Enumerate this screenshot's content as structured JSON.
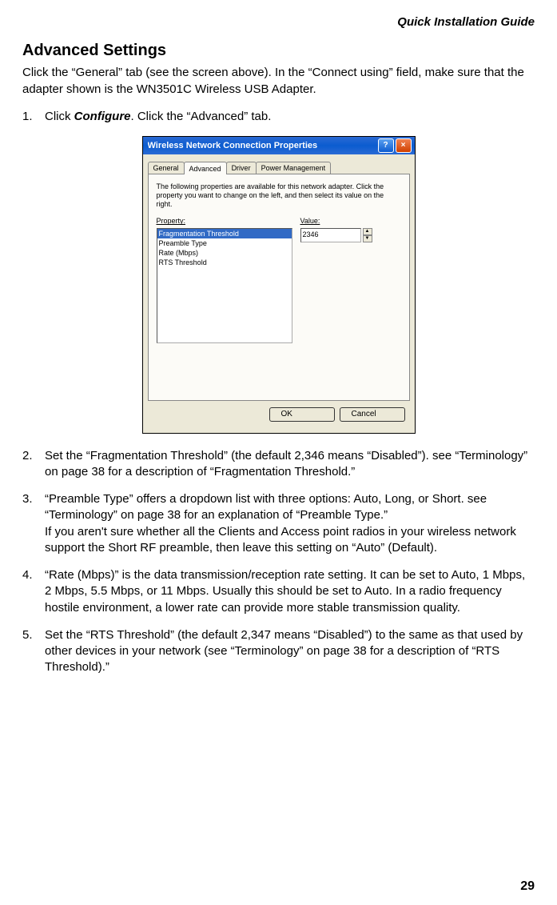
{
  "header": {
    "doc_title": "Quick Installation Guide"
  },
  "section": {
    "heading": "Advanced Settings",
    "intro": "Click the “General” tab (see the screen above). In the “Connect using” field, make sure that the adapter shown is the WN3501C Wireless USB Adapter."
  },
  "steps": {
    "s1_num": "1.",
    "s1_pre": "Click ",
    "s1_em": "Configure",
    "s1_post": ". Click the “Advanced” tab.",
    "s2_num": "2.",
    "s2_text": "Set the “Fragmentation Threshold” (the default 2,346 means “Disabled”). see “Terminology” on page 38 for a description of “Fragmentation Threshold.”",
    "s3_num": "3.",
    "s3_text": "“Preamble Type” offers a dropdown list with three options: Auto, Long, or Short. see “Terminology” on page 38 for an explanation of “Preamble Type.”\nIf you aren't sure whether all the Clients and Access point radios in your wireless network support the Short RF preamble, then leave this setting on “Auto” (Default).",
    "s4_num": "4.",
    "s4_text": "“Rate (Mbps)” is the data transmission/reception rate setting. It can be set to Auto, 1 Mbps, 2 Mbps, 5.5 Mbps, or 11 Mbps. Usually this should be set to Auto. In a radio frequency hostile environment, a lower rate can provide more stable transmission quality.",
    "s5_num": "5.",
    "s5_text": "Set the “RTS Threshold” (the default 2,347 means “Disabled”) to the same as that used by other devices in your network (see “Terminology” on page 38 for a description of “RTS Threshold).”"
  },
  "dialog": {
    "title": "Wireless Network Connection Properties",
    "help_label": "?",
    "close_label": "×",
    "tabs": {
      "general": "General",
      "advanced": "Advanced",
      "driver": "Driver",
      "power": "Power Management"
    },
    "instruction": "The following properties are available for this network adapter. Click the property you want to change on the left, and then select its value on the right.",
    "property_label": "Property:",
    "value_label": "Value:",
    "properties": [
      "Fragmentation Threshold",
      "Preamble Type",
      "Rate (Mbps)",
      "RTS Threshold"
    ],
    "value": "2346",
    "ok_label": "OK",
    "cancel_label": "Cancel"
  },
  "page_number": "29"
}
